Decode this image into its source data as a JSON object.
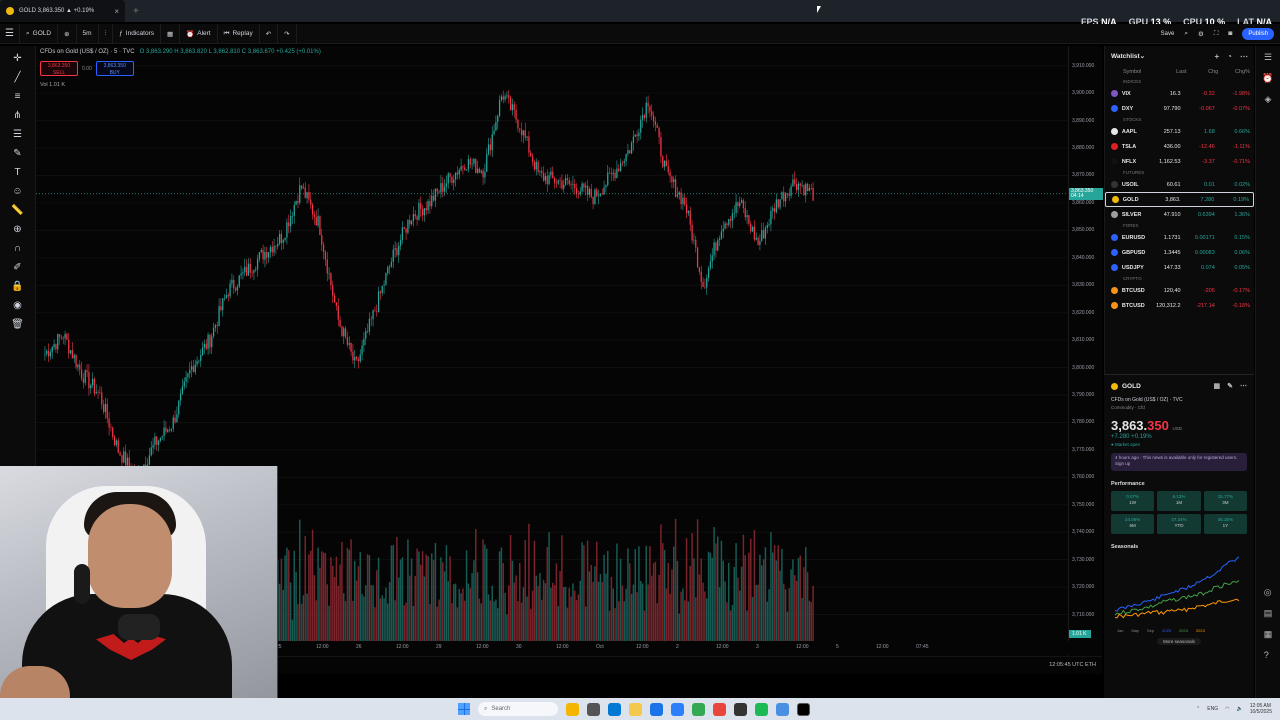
{
  "browser": {
    "tab_title": "GOLD 3,863.350 ▲ +0.19%",
    "new_tab": "+"
  },
  "perf_overlay": [
    {
      "label": "FPS",
      "value": "N/A"
    },
    {
      "label": "GPU",
      "value": "13 %"
    },
    {
      "label": "CPU",
      "value": "10 %"
    },
    {
      "label": "LAT",
      "value": "N/A"
    }
  ],
  "toolbar": {
    "symbol": "GOLD",
    "interval": "5m",
    "indicators": "Indicators",
    "alert": "Alert",
    "replay": "Replay",
    "save": "Save",
    "publish": "Publish"
  },
  "chart_header": {
    "title": "CFDs on Gold (US$ / OZ) · 5 · TVC",
    "ohlc": "O 3,863.290  H 3,863.820  L 3,862.810  C 3,863.670  +0.425 (+0.01%)",
    "sell_price": "3,863.350",
    "sell_label": "SELL",
    "buy_price": "3,863.350",
    "buy_label": "BUY",
    "spread": "0.00",
    "volume": "Vol  1.01 K"
  },
  "chart_data": {
    "type": "candlestick",
    "title": "CFDs on Gold (US$ / OZ) · 5 · TVC",
    "xlabel": "",
    "ylabel": "",
    "ylim": [
      3700,
      3915
    ],
    "y_ticks": [
      "3,910.000",
      "3,900.000",
      "3,890.000",
      "3,880.000",
      "3,870.000",
      "3,860.000",
      "3,850.000",
      "3,840.000",
      "3,830.000",
      "3,820.000",
      "3,810.000",
      "3,800.000",
      "3,790.000",
      "3,780.000",
      "3,770.000",
      "3,760.000",
      "3,750.000",
      "3,740.000",
      "3,730.000",
      "3,720.000",
      "3,710.000"
    ],
    "x_ticks": [
      "25",
      "12:00",
      "26",
      "12:00",
      "29",
      "12:00",
      "30",
      "12:00",
      "Oct",
      "12:00",
      "2",
      "12:00",
      "3",
      "12:00",
      "5",
      "12:00",
      "07:45"
    ],
    "close_path": [
      3805,
      3812,
      3798,
      3790,
      3770,
      3760,
      3772,
      3780,
      3800,
      3810,
      3828,
      3835,
      3842,
      3848,
      3866,
      3852,
      3818,
      3800,
      3820,
      3840,
      3855,
      3860,
      3868,
      3875,
      3872,
      3900,
      3888,
      3870,
      3868,
      3866,
      3862,
      3870,
      3880,
      3898,
      3870,
      3860,
      3830,
      3852,
      3860,
      3845,
      3860,
      3868,
      3863.35
    ],
    "last_price": "3,863.350",
    "last_price_time": "04:14",
    "last_volume": "1.01 K"
  },
  "timeaxis": {
    "utc": "12:05:45 UTC",
    "session": "ETH"
  },
  "watchlist": {
    "title": "Watchlist",
    "columns": [
      "Symbol",
      "Last",
      "Chg",
      "Chg%"
    ],
    "sections": [
      {
        "name": "INDICES",
        "rows": [
          {
            "sym": "VIX",
            "last": "16.3",
            "chg": "-0.32",
            "pct": "-1.98%",
            "dir": "dn",
            "color": "#7e57c2"
          },
          {
            "sym": "DXY",
            "last": "97.790",
            "chg": "-0.067",
            "pct": "-0.07%",
            "dir": "dn",
            "color": "#2962ff"
          }
        ]
      },
      {
        "name": "STOCKS",
        "rows": [
          {
            "sym": "AAPL",
            "last": "257.13",
            "chg": "1.68",
            "pct": "0.66%",
            "dir": "up",
            "color": "#e6e6e6"
          },
          {
            "sym": "TSLA",
            "last": "436.00",
            "chg": "-12.46",
            "pct": "-1.11%",
            "dir": "dn",
            "color": "#e02020"
          },
          {
            "sym": "NFLX",
            "last": "1,162.53",
            "chg": "-3.37",
            "pct": "-0.71%",
            "dir": "dn",
            "color": "#111111"
          }
        ]
      },
      {
        "name": "FUTURES",
        "rows": [
          {
            "sym": "USOIL",
            "last": "60.61",
            "chg": "0.01",
            "pct": "0.02%",
            "dir": "up",
            "color": "#333333"
          },
          {
            "sym": "GOLD",
            "last": "3,863.",
            "chg": "7.280",
            "pct": "0.19%",
            "dir": "up",
            "color": "#f0b90b"
          },
          {
            "sym": "SILVER",
            "last": "47.910",
            "chg": "0.6394",
            "pct": "1.36%",
            "dir": "up",
            "color": "#9e9e9e"
          }
        ]
      },
      {
        "name": "FOREX",
        "rows": [
          {
            "sym": "EURUSD",
            "last": "1.1731",
            "chg": "0.00171",
            "pct": "0.15%",
            "dir": "up",
            "color": "#2962ff"
          },
          {
            "sym": "GBPUSD",
            "last": "1.3445",
            "chg": "0.00083",
            "pct": "0.06%",
            "dir": "up",
            "color": "#2962ff"
          },
          {
            "sym": "USDJPY",
            "last": "147.33",
            "chg": "0.074",
            "pct": "0.05%",
            "dir": "up",
            "color": "#2962ff"
          }
        ]
      },
      {
        "name": "CRYPTO",
        "rows": [
          {
            "sym": "BTCUSD",
            "last": "120,40",
            "chg": "-205",
            "pct": "-0.17%",
            "dir": "dn",
            "color": "#f7931a"
          },
          {
            "sym": "BTCUSD",
            "last": "120,312.2",
            "chg": "-217.14",
            "pct": "-0.18%",
            "dir": "dn",
            "color": "#f7931a"
          }
        ]
      }
    ]
  },
  "details": {
    "symbol": "GOLD",
    "name": "CFDs on Gold (US$ / OZ) · TVC",
    "type": "Commodity · Cfd",
    "price_main": "3,863.",
    "price_tail": "350",
    "currency": "USD",
    "change": "+7.280 +0.19%",
    "market": "● Market open",
    "news": "4 hours ago · This news is available only for registered users. Sign up",
    "performance_title": "Performance",
    "performance": [
      {
        "value": "0.07%",
        "label": "1W"
      },
      {
        "value": "6.13%",
        "label": "1M"
      },
      {
        "value": "15.77%",
        "label": "3M"
      },
      {
        "value": "24.06%",
        "label": "6M"
      },
      {
        "value": "47.24%",
        "label": "YTD"
      },
      {
        "value": "45.35%",
        "label": "1Y"
      }
    ],
    "seasonals_title": "Seasonals",
    "seasonals_axis": [
      "Jan",
      "May",
      "Sep"
    ],
    "seasonals_legend": [
      "2025",
      "2024",
      "2023"
    ],
    "seasonals_more": "More seasonals"
  },
  "taskbar": {
    "search": "Search",
    "lang": "ENG",
    "time": "12:05 AM",
    "date": "10/5/2025"
  }
}
